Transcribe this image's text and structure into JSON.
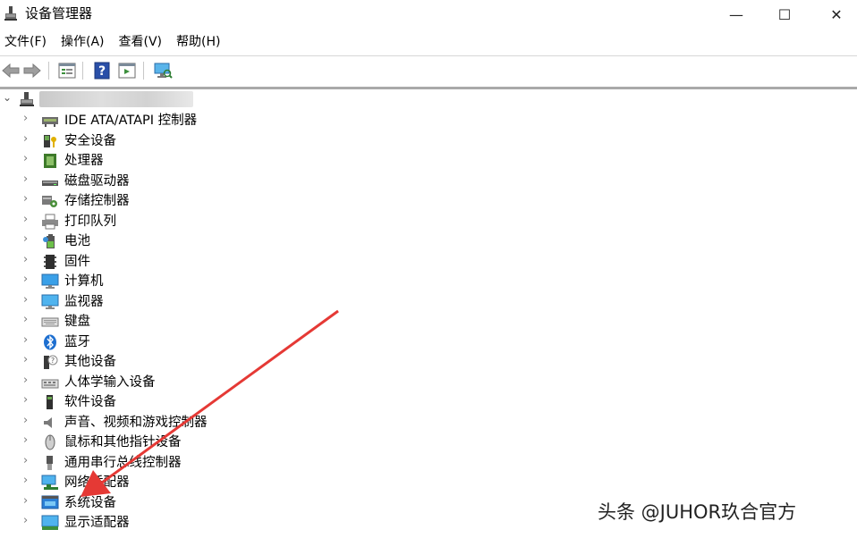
{
  "window": {
    "title": "设备管理器",
    "controls": {
      "minimize": "—",
      "maximize": "☐",
      "close": "✕"
    }
  },
  "menu": [
    {
      "label": "文件(F)"
    },
    {
      "label": "操作(A)"
    },
    {
      "label": "查看(V)"
    },
    {
      "label": "帮助(H)"
    }
  ],
  "toolbar": {
    "icons": [
      "back-arrow-icon",
      "forward-arrow-icon",
      "properties-icon",
      "help-icon",
      "action-icon",
      "scan-hardware-icon"
    ]
  },
  "tree": {
    "root": {
      "expanded": true,
      "name_redacted": true
    },
    "items": [
      {
        "label": "IDE ATA/ATAPI 控制器",
        "icon": "ide-controller-icon"
      },
      {
        "label": "安全设备",
        "icon": "security-device-icon"
      },
      {
        "label": "处理器",
        "icon": "processor-icon"
      },
      {
        "label": "磁盘驱动器",
        "icon": "disk-drive-icon"
      },
      {
        "label": "存储控制器",
        "icon": "storage-controller-icon"
      },
      {
        "label": "打印队列",
        "icon": "printer-icon"
      },
      {
        "label": "电池",
        "icon": "battery-icon"
      },
      {
        "label": "固件",
        "icon": "firmware-icon"
      },
      {
        "label": "计算机",
        "icon": "computer-icon"
      },
      {
        "label": "监视器",
        "icon": "monitor-icon"
      },
      {
        "label": "键盘",
        "icon": "keyboard-icon"
      },
      {
        "label": "蓝牙",
        "icon": "bluetooth-icon"
      },
      {
        "label": "其他设备",
        "icon": "other-device-icon"
      },
      {
        "label": "人体学输入设备",
        "icon": "hid-icon"
      },
      {
        "label": "软件设备",
        "icon": "software-device-icon"
      },
      {
        "label": "声音、视频和游戏控制器",
        "icon": "sound-icon"
      },
      {
        "label": "鼠标和其他指针设备",
        "icon": "mouse-icon"
      },
      {
        "label": "通用串行总线控制器",
        "icon": "usb-icon"
      },
      {
        "label": "网络适配器",
        "icon": "network-adapter-icon"
      },
      {
        "label": "系统设备",
        "icon": "system-device-icon"
      },
      {
        "label": "显示适配器",
        "icon": "display-adapter-icon"
      }
    ]
  },
  "annotation": {
    "arrow_color": "#e53935",
    "points_to": "系统设备"
  },
  "watermark": "头条 @JUHOR玖合官方",
  "colors": {
    "accent_blue": "#2b7fd6",
    "monitor_blue": "#3aa0e8",
    "border_gray": "#a9a9a9"
  }
}
